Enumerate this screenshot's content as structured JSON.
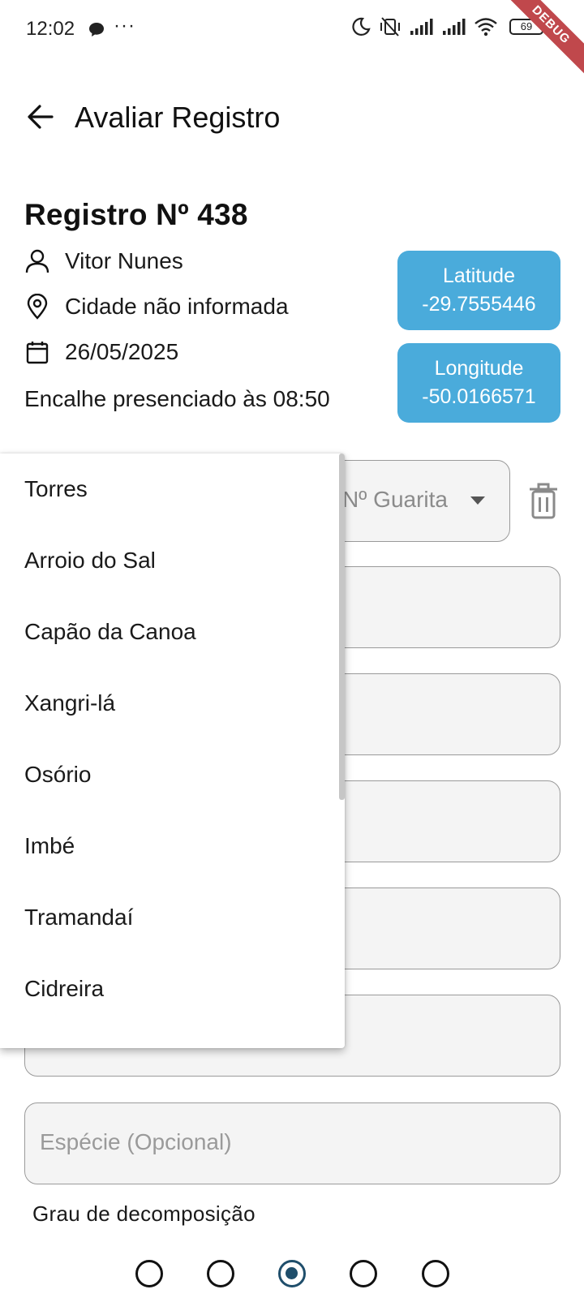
{
  "status_bar": {
    "time": "12:02",
    "dots": "···",
    "battery": "69",
    "debug_banner": "DEBUG"
  },
  "app_bar": {
    "title": "Avaliar Registro",
    "back_icon": "arrow-left-icon"
  },
  "record": {
    "title": "Registro Nº 438",
    "user": "Vitor Nunes",
    "city": "Cidade não informada",
    "date": "26/05/2025",
    "sighting": "Encalhe presenciado às 08:50",
    "latitude_label": "Latitude",
    "latitude_value": "-29.7555446",
    "longitude_label": "Longitude",
    "longitude_value": "-50.0166571",
    "coord_color": "#4aabdb"
  },
  "form": {
    "guarita_placeholder": "Nº Guarita",
    "species_placeholder": "Espécie (Opcional)",
    "decomposition_label": "Grau de decomposição",
    "decomposition_options_count": 5,
    "decomposition_selected_index": 2
  },
  "dropdown": {
    "items": [
      "Torres",
      "Arroio do Sal",
      "Capão da Canoa",
      "Xangri-lá",
      "Osório",
      "Imbé",
      "Tramandaí",
      "Cidreira"
    ]
  }
}
